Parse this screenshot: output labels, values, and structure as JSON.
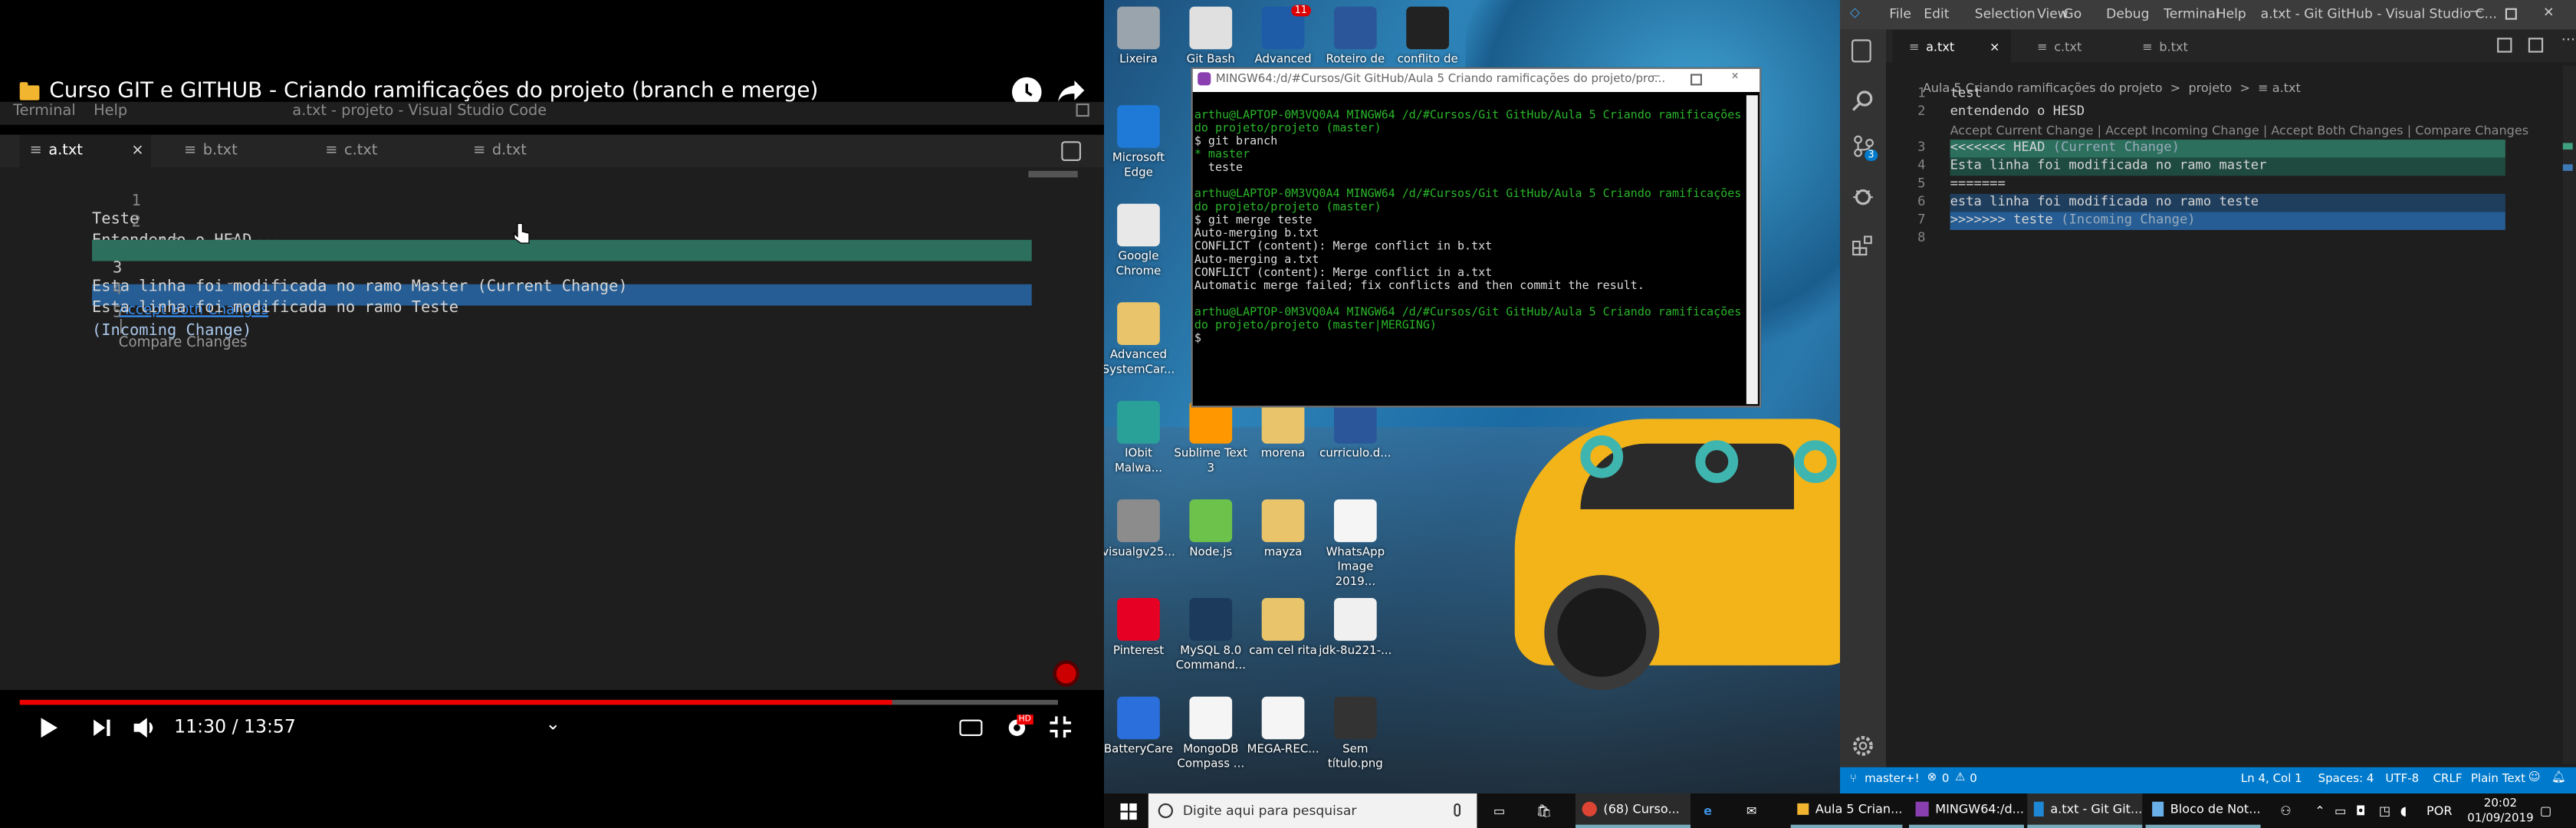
{
  "video": {
    "title": "Curso GIT e GITHUB - Criando ramificações do projeto (branch e merge)",
    "menu": [
      "Terminal",
      "Help"
    ],
    "window_title": "a.txt - projeto - Visual Studio Code",
    "tabs": [
      "a.txt",
      "b.txt",
      "c.txt",
      "d.txt"
    ],
    "lines": [
      {
        "n": "1",
        "text": "Teste"
      },
      {
        "n": "2",
        "text": "Entendendo o HEAD"
      },
      {
        "n": "3",
        "text": "Esta linha foi modificada no ramo Master (Current Change)"
      },
      {
        "n": "4",
        "text": "Esta linha foi modificada no ramo Teste"
      },
      {
        "n": "5",
        "text": "(Incoming Change)"
      }
    ],
    "codelens": {
      "accept_current": "Accept Current Change",
      "accept_incoming": "Accept Incoming Change",
      "accept_both": "Accept Both Changes",
      "compare": "Compare Changes",
      "sep": "|"
    },
    "time": "11:30 / 13:57",
    "progress": 0.84,
    "hd": "HD"
  },
  "desktop": {
    "icons": [
      {
        "label": "Lixeira",
        "color": "#9aa4ad"
      },
      {
        "label": "Git Bash",
        "color": "#e0e0e0"
      },
      {
        "label": "Advanced",
        "color": "#1f5ca8"
      },
      {
        "label": "Roteiro de",
        "color": "#2b579a"
      },
      {
        "label": "conflito de",
        "color": "#222222"
      },
      {
        "label": "Microsoft Edge",
        "color": "#1e7ad6"
      },
      {
        "label": "Google Chrome",
        "color": "#e8e8e8"
      },
      {
        "label": "Advanced SystemCar...",
        "color": "#e9c46a"
      },
      {
        "label": "IObit Malwa...",
        "color": "#2aa198"
      },
      {
        "label": "Sublime Text 3",
        "color": "#ff9800"
      },
      {
        "label": "morena",
        "color": "#e9c46a"
      },
      {
        "label": "curriculo.d...",
        "color": "#2b579a"
      },
      {
        "label": "visualgv25...",
        "color": "#8c8c8c"
      },
      {
        "label": "Node.js",
        "color": "#6cc24a"
      },
      {
        "label": "mayza",
        "color": "#e9c46a"
      },
      {
        "label": "WhatsApp Image 2019...",
        "color": "#f5f5f5"
      },
      {
        "label": "Pinterest",
        "color": "#e60023"
      },
      {
        "label": "MySQL 8.0 Command...",
        "color": "#1b3a5c"
      },
      {
        "label": "cam cel rita",
        "color": "#e9c46a"
      },
      {
        "label": "jdk-8u221-...",
        "color": "#f0f0f0"
      },
      {
        "label": "BatteryCare",
        "color": "#2a6fdb"
      },
      {
        "label": "MongoDB Compass ...",
        "color": "#f5f5f5"
      },
      {
        "label": "MEGA-REC...",
        "color": "#f5f5f5"
      },
      {
        "label": "Sem título.png",
        "color": "#333333"
      }
    ],
    "badge": "11"
  },
  "terminal": {
    "title": "MINGW64:/d/#Cursos/Git GitHub/Aula 5 Criando ramificações do projeto/pro...",
    "lines": [
      {
        "text": "arthu@LAPTOP-0M3VQ0A4 MINGW64 /d/#Cursos/Git GitHub/Aula 5 Criando ramificações",
        "color": "#2bb52b"
      },
      {
        "text": "do projeto/projeto (master)",
        "color": "#2bb52b"
      },
      {
        "text": "$ git branch",
        "color": "#dddddd"
      },
      {
        "text": "* master",
        "color": "#2bb52b"
      },
      {
        "text": "  teste",
        "color": "#dddddd"
      },
      {
        "text": "",
        "color": "#dddddd"
      },
      {
        "text": "arthu@LAPTOP-0M3VQ0A4 MINGW64 /d/#Cursos/Git GitHub/Aula 5 Criando ramificações",
        "color": "#2bb52b"
      },
      {
        "text": "do projeto/projeto (master)",
        "color": "#2bb52b"
      },
      {
        "text": "$ git merge teste",
        "color": "#dddddd"
      },
      {
        "text": "Auto-merging b.txt",
        "color": "#dddddd"
      },
      {
        "text": "CONFLICT (content): Merge conflict in b.txt",
        "color": "#dddddd"
      },
      {
        "text": "Auto-merging a.txt",
        "color": "#dddddd"
      },
      {
        "text": "CONFLICT (content): Merge conflict in a.txt",
        "color": "#dddddd"
      },
      {
        "text": "Automatic merge failed; fix conflicts and then commit the result.",
        "color": "#dddddd"
      },
      {
        "text": "",
        "color": "#dddddd"
      },
      {
        "text": "arthu@LAPTOP-0M3VQ0A4 MINGW64 /d/#Cursos/Git GitHub/Aula 5 Criando ramificações",
        "color": "#2bb52b"
      },
      {
        "text": "do projeto/projeto (master|MERGING)",
        "color": "#2bb52b"
      },
      {
        "text": "$",
        "color": "#dddddd"
      }
    ]
  },
  "vscode": {
    "menu": [
      "File",
      "Edit",
      "Selection",
      "View",
      "Go",
      "Debug",
      "Terminal",
      "Help"
    ],
    "window_title": "a.txt - Git GitHub - Visual Studio C...",
    "tabs": [
      "a.txt",
      "c.txt",
      "b.txt"
    ],
    "breadcrumb": "Aula 5 Criando ramificações do projeto  >  projeto  >  ",
    "breadcrumb_file": "a.txt",
    "codelens": "Accept Current Change | Accept Incoming Change | Accept Both Changes | Compare Changes",
    "lines": [
      {
        "n": "1",
        "text": "test",
        "hint": ""
      },
      {
        "n": "2",
        "text": "entendendo o HESD",
        "hint": ""
      },
      {
        "n": "3",
        "text": "<<<<<<< HEAD",
        "hint": " (Current Change)"
      },
      {
        "n": "4",
        "text": "Esta linha foi modificada no ramo master",
        "hint": ""
      },
      {
        "n": "5",
        "text": "=======",
        "hint": ""
      },
      {
        "n": "6",
        "text": "esta linha foi modificada no ramo teste",
        "hint": ""
      },
      {
        "n": "7",
        "text": ">>>>>>> teste",
        "hint": " (Incoming Change)"
      },
      {
        "n": "8",
        "text": "",
        "hint": ""
      }
    ],
    "scm_badge": "3",
    "status_left": [
      "master+!",
      "0",
      "0"
    ],
    "status_right": [
      "Ln 4, Col 1",
      "Spaces: 4",
      "UTF-8",
      "CRLF",
      "Plain Text"
    ]
  },
  "taskbar": {
    "search_placeholder": "Digite aqui para pesquisar",
    "apps": [
      "(68) Curso...",
      "Aula 5 Crian...",
      "MINGW64:/d...",
      "a.txt - Git Git...",
      "Bloco de Not..."
    ],
    "lang": "POR",
    "time": "20:02",
    "date": "01/09/2019"
  }
}
